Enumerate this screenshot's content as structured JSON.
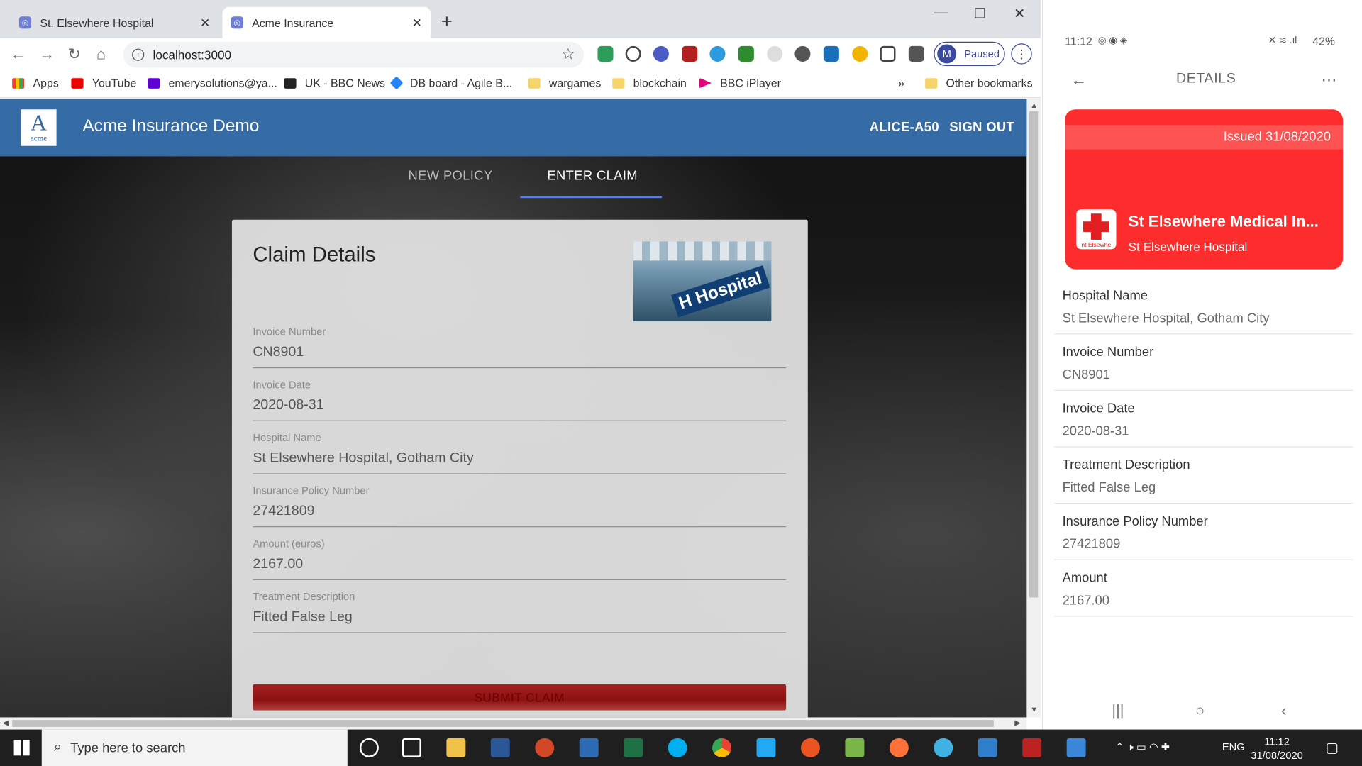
{
  "browser": {
    "tabs": [
      {
        "title": "St. Elsewhere Hospital"
      },
      {
        "title": "Acme Insurance"
      }
    ],
    "url": "localhost:3000",
    "profile_status": "Paused",
    "profile_initial": "M",
    "bookmarks": [
      "Apps",
      "YouTube",
      "emerysolutions@ya...",
      "UK - BBC News",
      "DB board - Agile B...",
      "wargames",
      "blockchain",
      "BBC iPlayer",
      "Other bookmarks"
    ],
    "bookmarks_more": "»"
  },
  "app": {
    "logo_letter": "A",
    "logo_text": "acme",
    "title": "Acme Insurance Demo",
    "user": "ALICE-A50",
    "signout": "SIGN OUT",
    "nav_tabs": [
      {
        "label": "NEW POLICY",
        "active": false
      },
      {
        "label": "ENTER CLAIM",
        "active": true
      }
    ]
  },
  "claim": {
    "heading": "Claim Details",
    "image_sign": "H Hospital",
    "fields": [
      {
        "label": "Invoice Number",
        "value": "CN8901"
      },
      {
        "label": "Invoice Date",
        "value": "2020-08-31"
      },
      {
        "label": "Hospital Name",
        "value": "St Elsewhere Hospital, Gotham City"
      },
      {
        "label": "Insurance Policy Number",
        "value": "27421809"
      },
      {
        "label": "Amount (euros)",
        "value": "2167.00"
      },
      {
        "label": "Treatment Description",
        "value": "Fitted False Leg"
      }
    ],
    "submit": "SUBMIT CLAIM"
  },
  "phone": {
    "time": "11:12",
    "battery": "42%",
    "header": "DETAILS",
    "card": {
      "issued": "Issued 31/08/2020",
      "name": "St Elsewhere Medical In...",
      "issuer": "St Elsewhere Hospital",
      "badge_text": "nt Elsewhe"
    },
    "rows": [
      {
        "label": "Hospital Name",
        "value": "St Elsewhere Hospital, Gotham City"
      },
      {
        "label": "Invoice Number",
        "value": "CN8901"
      },
      {
        "label": "Invoice Date",
        "value": "2020-08-31"
      },
      {
        "label": "Treatment Description",
        "value": "Fitted False Leg"
      },
      {
        "label": "Insurance Policy Number",
        "value": "27421809"
      },
      {
        "label": "Amount",
        "value": "2167.00"
      }
    ]
  },
  "taskbar": {
    "search_placeholder": "Type here to search",
    "lang": "ENG",
    "time": "11:12",
    "date": "31/08/2020"
  },
  "colors": {
    "appbar": "#356ca6",
    "submit": "#9b1515",
    "phone_card": "#fd2d2d",
    "tab_indicator": "#4f7ff0"
  }
}
